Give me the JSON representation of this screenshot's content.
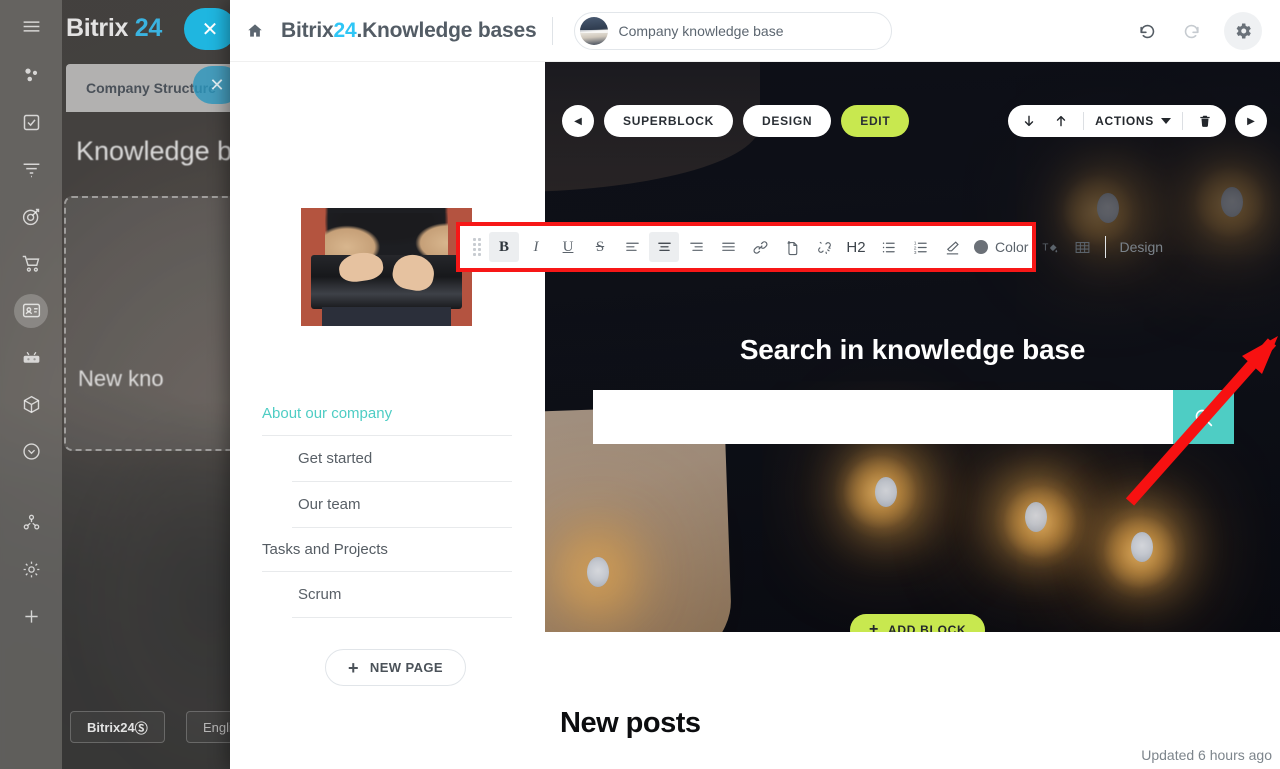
{
  "backdrop": {
    "logo_main": "Bitrix",
    "logo_accent": "24",
    "tab_label": "Company Structure",
    "page_title": "Knowledge bas",
    "card_text": "New kno",
    "footer_brand": "Bitrix24",
    "footer_lang": "English",
    "close_glyph": "✕",
    "tab_close_glyph": "✕",
    "rail_icons": [
      "menu-icon",
      "crm-icon",
      "tasks-icon",
      "feed-icon",
      "goals-icon",
      "shop-icon",
      "contacts-icon",
      "automation-icon",
      "storage-icon",
      "more-icon",
      "sites-icon",
      "settings-icon",
      "add-icon"
    ]
  },
  "topbar": {
    "home_icon": "home-icon",
    "title_prefix": "Bitrix",
    "title_accent": "24",
    "title_suffix": ".Knowledge bases",
    "kb_selector_value": "Company knowledge base",
    "undo_icon": "undo-icon",
    "redo_icon": "redo-icon",
    "settings_icon": "gear-icon"
  },
  "left_panel": {
    "thumbnail_alt": "hands typing on laptop",
    "nav_items": [
      {
        "label": "About our company",
        "level": 0,
        "active": true
      },
      {
        "label": "Get started",
        "level": 1,
        "active": false
      },
      {
        "label": "Our team",
        "level": 1,
        "active": false
      },
      {
        "label": "Tasks and Projects",
        "level": 0,
        "active": false
      },
      {
        "label": "Scrum",
        "level": 1,
        "active": false
      }
    ],
    "new_page_label": "NEW PAGE",
    "new_page_plus": "+"
  },
  "block_controls": {
    "prev_glyph": "◀",
    "next_glyph": "▶",
    "superblock_label": "SUPERBLOCK",
    "design_label": "DESIGN",
    "edit_label": "EDIT",
    "move_down_icon": "arrow-down-icon",
    "move_up_icon": "arrow-up-icon",
    "actions_label": "ACTIONS",
    "delete_icon": "trash-icon"
  },
  "format_toolbar": {
    "grip": "drag-handle-icon",
    "items": [
      {
        "name": "bold",
        "glyph": "B",
        "active": true
      },
      {
        "name": "italic",
        "glyph": "I",
        "active": false
      },
      {
        "name": "underline",
        "glyph": "U",
        "active": false
      },
      {
        "name": "strikethrough",
        "glyph": "S",
        "active": false
      },
      {
        "name": "align-left",
        "glyph": "",
        "active": false
      },
      {
        "name": "align-center",
        "glyph": "",
        "active": true
      },
      {
        "name": "align-right",
        "glyph": "",
        "active": false
      },
      {
        "name": "align-justify",
        "glyph": "",
        "active": false
      },
      {
        "name": "link",
        "glyph": "",
        "active": false
      },
      {
        "name": "anchor",
        "glyph": "",
        "active": false
      },
      {
        "name": "unlink",
        "glyph": "",
        "active": false
      },
      {
        "name": "heading-h2",
        "glyph": "H2",
        "active": false
      },
      {
        "name": "bullet-list",
        "glyph": "",
        "active": false
      },
      {
        "name": "numbered-list",
        "glyph": "",
        "active": false
      },
      {
        "name": "clear-format",
        "glyph": "",
        "active": false
      }
    ],
    "color_label": "Color",
    "color_swatch": "#6b7077",
    "background_color_icon": "text-background-icon",
    "table_icon": "table-icon",
    "design_label": "Design",
    "frame_color": "#f71717"
  },
  "hero": {
    "heading": "Search in knowledge base",
    "search_placeholder": "",
    "search_value": "",
    "search_icon": "search-icon",
    "search_button_color": "#4ecdc4",
    "add_block_label": "ADD BLOCK",
    "add_block_plus": "+"
  },
  "content": {
    "new_posts_title": "New posts",
    "updated_text": "Updated 6 hours ago"
  }
}
